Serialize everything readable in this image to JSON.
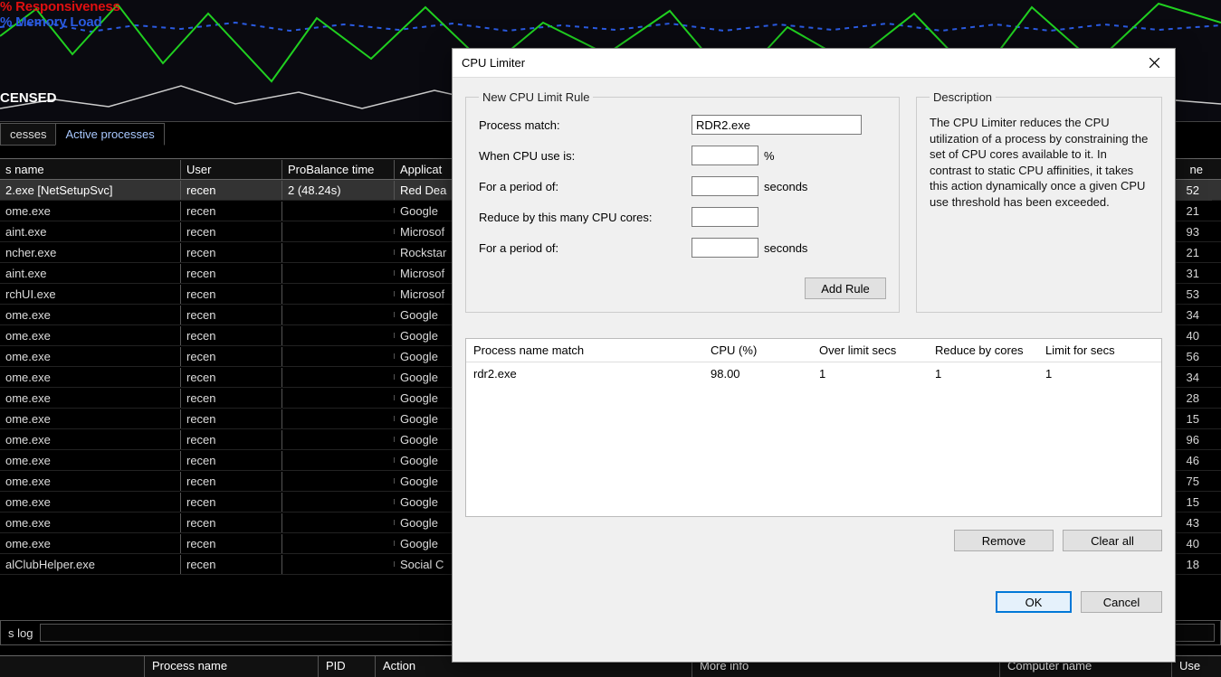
{
  "chart": {
    "legend_responsiveness": "% Responsiveness",
    "legend_memory": "% Memory Load",
    "licensed": "CENSED"
  },
  "tabs": {
    "left": "cesses",
    "active": "Active processes"
  },
  "proc_headers": {
    "name": "s name",
    "user": "User",
    "probalance": "ProBalance time",
    "application": "Applicat",
    "right": "ne"
  },
  "processes": [
    {
      "name": "2.exe [NetSetupSvc]",
      "user": "recen",
      "pro": "2 (48.24s)",
      "app": "Red Dea",
      "num": "52"
    },
    {
      "name": "ome.exe",
      "user": "recen",
      "pro": "",
      "app": "Google ",
      "num": "21"
    },
    {
      "name": "aint.exe",
      "user": "recen",
      "pro": "",
      "app": "Microsof",
      "num": "93"
    },
    {
      "name": "ncher.exe",
      "user": "recen",
      "pro": "",
      "app": "Rockstar",
      "num": "21"
    },
    {
      "name": "aint.exe",
      "user": "recen",
      "pro": "",
      "app": "Microsof",
      "num": "31"
    },
    {
      "name": "rchUI.exe",
      "user": "recen",
      "pro": "",
      "app": "Microsof",
      "num": "53"
    },
    {
      "name": "ome.exe",
      "user": "recen",
      "pro": "",
      "app": "Google ",
      "num": "34"
    },
    {
      "name": "ome.exe",
      "user": "recen",
      "pro": "",
      "app": "Google ",
      "num": "40"
    },
    {
      "name": "ome.exe",
      "user": "recen",
      "pro": "",
      "app": "Google ",
      "num": "56"
    },
    {
      "name": "ome.exe",
      "user": "recen",
      "pro": "",
      "app": "Google ",
      "num": "34"
    },
    {
      "name": "ome.exe",
      "user": "recen",
      "pro": "",
      "app": "Google ",
      "num": "28"
    },
    {
      "name": "ome.exe",
      "user": "recen",
      "pro": "",
      "app": "Google ",
      "num": "15"
    },
    {
      "name": "ome.exe",
      "user": "recen",
      "pro": "",
      "app": "Google ",
      "num": "96"
    },
    {
      "name": "ome.exe",
      "user": "recen",
      "pro": "",
      "app": "Google ",
      "num": "46"
    },
    {
      "name": "ome.exe",
      "user": "recen",
      "pro": "",
      "app": "Google ",
      "num": "75"
    },
    {
      "name": "ome.exe",
      "user": "recen",
      "pro": "",
      "app": "Google ",
      "num": "15"
    },
    {
      "name": "ome.exe",
      "user": "recen",
      "pro": "",
      "app": "Google ",
      "num": "43"
    },
    {
      "name": "ome.exe",
      "user": "recen",
      "pro": "",
      "app": "Google ",
      "num": "40"
    },
    {
      "name": "alClubHelper.exe",
      "user": "recen",
      "pro": "",
      "app": "Social C",
      "num": "18"
    }
  ],
  "log": {
    "label": "s log"
  },
  "bottom": {
    "blank": "",
    "procname": "Process name",
    "pid": "PID",
    "action": "Action",
    "moreinfo": "More info",
    "computer": "Computer name",
    "user": "Use"
  },
  "dialog": {
    "title": "CPU Limiter",
    "group_rule_title": "New CPU Limit Rule",
    "group_desc_title": "Description",
    "labels": {
      "process_match": "Process match:",
      "when_cpu": "When CPU use is:",
      "period1": "For a period of:",
      "reduce": "Reduce by this many CPU cores:",
      "period2": "For a period of:"
    },
    "values": {
      "process_match": "RDR2.exe",
      "when_cpu": "",
      "period1": "",
      "reduce": "",
      "period2": ""
    },
    "suffix": {
      "percent": "%",
      "seconds": "seconds"
    },
    "add_rule": "Add Rule",
    "description": "The CPU Limiter reduces the CPU utilization of a process by constraining the set of CPU cores available to it. In contrast to static CPU affinities, it takes this action dynamically once a given CPU use threshold has been exceeded.",
    "list_headers": {
      "name": "Process name match",
      "cpu": "CPU (%)",
      "over": "Over limit secs",
      "reduce": "Reduce by cores",
      "limit": "Limit for secs"
    },
    "list_rows": [
      {
        "name": "rdr2.exe",
        "cpu": "98.00",
        "over": "1",
        "reduce": "1",
        "limit": "1"
      }
    ],
    "btn_remove": "Remove",
    "btn_clearall": "Clear all",
    "btn_ok": "OK",
    "btn_cancel": "Cancel"
  }
}
